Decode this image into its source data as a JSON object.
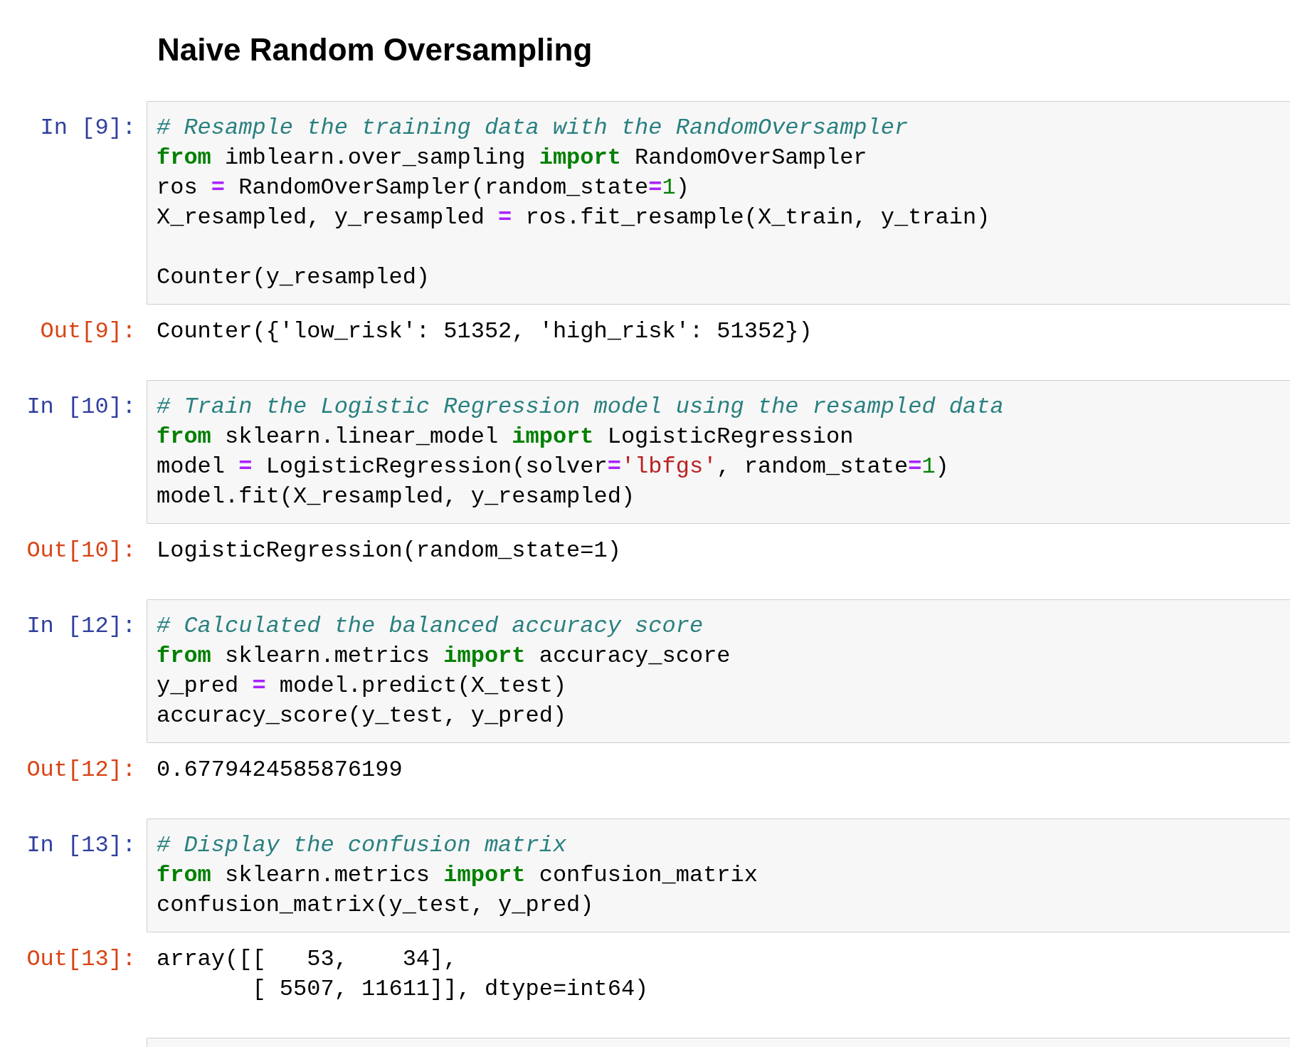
{
  "heading": "Naive Random Oversampling",
  "cells": [
    {
      "kind": "code",
      "prompt": "In [9]:",
      "lines": [
        {
          "kind": "code",
          "tokens": [
            {
              "kind": "comment",
              "text": "# Resample the training data with the RandomOversampler"
            }
          ]
        },
        {
          "kind": "code",
          "tokens": [
            {
              "kind": "keyword",
              "text": "from"
            },
            {
              "kind": "plain",
              "text": " imblearn.over_sampling "
            },
            {
              "kind": "keyword",
              "text": "import"
            },
            {
              "kind": "plain",
              "text": " RandomOverSampler"
            }
          ]
        },
        {
          "kind": "code",
          "tokens": [
            {
              "kind": "plain",
              "text": "ros "
            },
            {
              "kind": "operator",
              "text": "="
            },
            {
              "kind": "plain",
              "text": " RandomOverSampler(random_state"
            },
            {
              "kind": "operator",
              "text": "="
            },
            {
              "kind": "number",
              "text": "1"
            },
            {
              "kind": "plain",
              "text": ")"
            }
          ]
        },
        {
          "kind": "code",
          "tokens": [
            {
              "kind": "plain",
              "text": "X_resampled, y_resampled "
            },
            {
              "kind": "operator",
              "text": "="
            },
            {
              "kind": "plain",
              "text": " ros.fit_resample(X_train, y_train)"
            }
          ]
        },
        {
          "kind": "blank"
        },
        {
          "kind": "code",
          "tokens": [
            {
              "kind": "plain",
              "text": "Counter(y_resampled)"
            }
          ]
        }
      ],
      "output": {
        "prompt": "Out[9]:",
        "lines": [
          "Counter({'low_risk': 51352, 'high_risk': 51352})"
        ]
      }
    },
    {
      "kind": "code",
      "prompt": "In [10]:",
      "lines": [
        {
          "kind": "code",
          "tokens": [
            {
              "kind": "comment",
              "text": "# Train the Logistic Regression model using the resampled data"
            }
          ]
        },
        {
          "kind": "code",
          "tokens": [
            {
              "kind": "keyword",
              "text": "from"
            },
            {
              "kind": "plain",
              "text": " sklearn.linear_model "
            },
            {
              "kind": "keyword",
              "text": "import"
            },
            {
              "kind": "plain",
              "text": " LogisticRegression"
            }
          ]
        },
        {
          "kind": "code",
          "tokens": [
            {
              "kind": "plain",
              "text": "model "
            },
            {
              "kind": "operator",
              "text": "="
            },
            {
              "kind": "plain",
              "text": " LogisticRegression(solver"
            },
            {
              "kind": "operator",
              "text": "="
            },
            {
              "kind": "string",
              "text": "'lbfgs'"
            },
            {
              "kind": "plain",
              "text": ", random_state"
            },
            {
              "kind": "operator",
              "text": "="
            },
            {
              "kind": "number",
              "text": "1"
            },
            {
              "kind": "plain",
              "text": ")"
            }
          ]
        },
        {
          "kind": "code",
          "tokens": [
            {
              "kind": "plain",
              "text": "model.fit(X_resampled, y_resampled)"
            }
          ]
        }
      ],
      "output": {
        "prompt": "Out[10]:",
        "lines": [
          "LogisticRegression(random_state=1)"
        ]
      }
    },
    {
      "kind": "code",
      "prompt": "In [12]:",
      "lines": [
        {
          "kind": "code",
          "tokens": [
            {
              "kind": "comment",
              "text": "# Calculated the balanced accuracy score"
            }
          ]
        },
        {
          "kind": "code",
          "tokens": [
            {
              "kind": "keyword",
              "text": "from"
            },
            {
              "kind": "plain",
              "text": " sklearn.metrics "
            },
            {
              "kind": "keyword",
              "text": "import"
            },
            {
              "kind": "plain",
              "text": " accuracy_score"
            }
          ]
        },
        {
          "kind": "code",
          "tokens": [
            {
              "kind": "plain",
              "text": "y_pred "
            },
            {
              "kind": "operator",
              "text": "="
            },
            {
              "kind": "plain",
              "text": " model.predict(X_test)"
            }
          ]
        },
        {
          "kind": "code",
          "tokens": [
            {
              "kind": "plain",
              "text": "accuracy_score(y_test, y_pred)"
            }
          ]
        }
      ],
      "output": {
        "prompt": "Out[12]:",
        "lines": [
          "0.6779424585876199"
        ]
      }
    },
    {
      "kind": "code",
      "prompt": "In [13]:",
      "lines": [
        {
          "kind": "code",
          "tokens": [
            {
              "kind": "comment",
              "text": "# Display the confusion matrix"
            }
          ]
        },
        {
          "kind": "code",
          "tokens": [
            {
              "kind": "keyword",
              "text": "from"
            },
            {
              "kind": "plain",
              "text": " sklearn.metrics "
            },
            {
              "kind": "keyword",
              "text": "import"
            },
            {
              "kind": "plain",
              "text": " confusion_matrix"
            }
          ]
        },
        {
          "kind": "code",
          "tokens": [
            {
              "kind": "plain",
              "text": "confusion_matrix(y_test, y_pred)"
            }
          ]
        }
      ],
      "output": {
        "prompt": "Out[13]:",
        "lines": [
          "array([[   53,    34],",
          "       [ 5507, 11611]], dtype=int64)"
        ]
      }
    },
    {
      "kind": "code"
    }
  ]
}
